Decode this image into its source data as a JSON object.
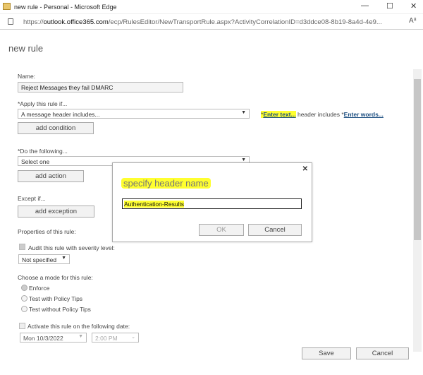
{
  "window": {
    "title": "new rule - Personal - Microsoft Edge",
    "url_prefix": "https://",
    "url_domain": "outlook.office365.com",
    "url_path": "/ecp/RulesEditor/NewTransportRule.aspx?ActivityCorrelationID=d3ddce08-8b19-8a4d-4e9...",
    "minimize": "—",
    "maximize": "☐",
    "close": "✕",
    "read_aloud": "A⁸"
  },
  "page": {
    "title": "new rule"
  },
  "form": {
    "name_label": "Name:",
    "name_value": "Reject Messages they fail DMARC",
    "apply_label": "*Apply this rule if...",
    "apply_value": "A message header includes...",
    "condition_star1": "*",
    "condition_link1": "Enter text...",
    "condition_middle": " header includes ",
    "condition_star2": "*",
    "condition_link2": "Enter words...",
    "add_condition": "add condition",
    "do_label": "*Do the following...",
    "do_value": "Select one",
    "add_action": "add action",
    "except_label": "Except if...",
    "add_exception": "add exception",
    "properties_label": "Properties of this rule:",
    "audit_label": "Audit this rule with severity level:",
    "severity_value": "Not specified",
    "mode_label": "Choose a mode for this rule:",
    "modes": [
      "Enforce",
      "Test with Policy Tips",
      "Test without Policy Tips"
    ],
    "activate_label": "Activate this rule on the following date:",
    "date_value": "Mon 10/3/2022",
    "time_value": "2:00 PM",
    "save": "Save",
    "cancel": "Cancel"
  },
  "dialog": {
    "title": "specify header name",
    "value": "Authentication-Results",
    "ok": "OK",
    "cancel": "Cancel",
    "close": "✕"
  },
  "colors": {
    "highlight": "#ffff30",
    "link": "#1a4d80"
  }
}
